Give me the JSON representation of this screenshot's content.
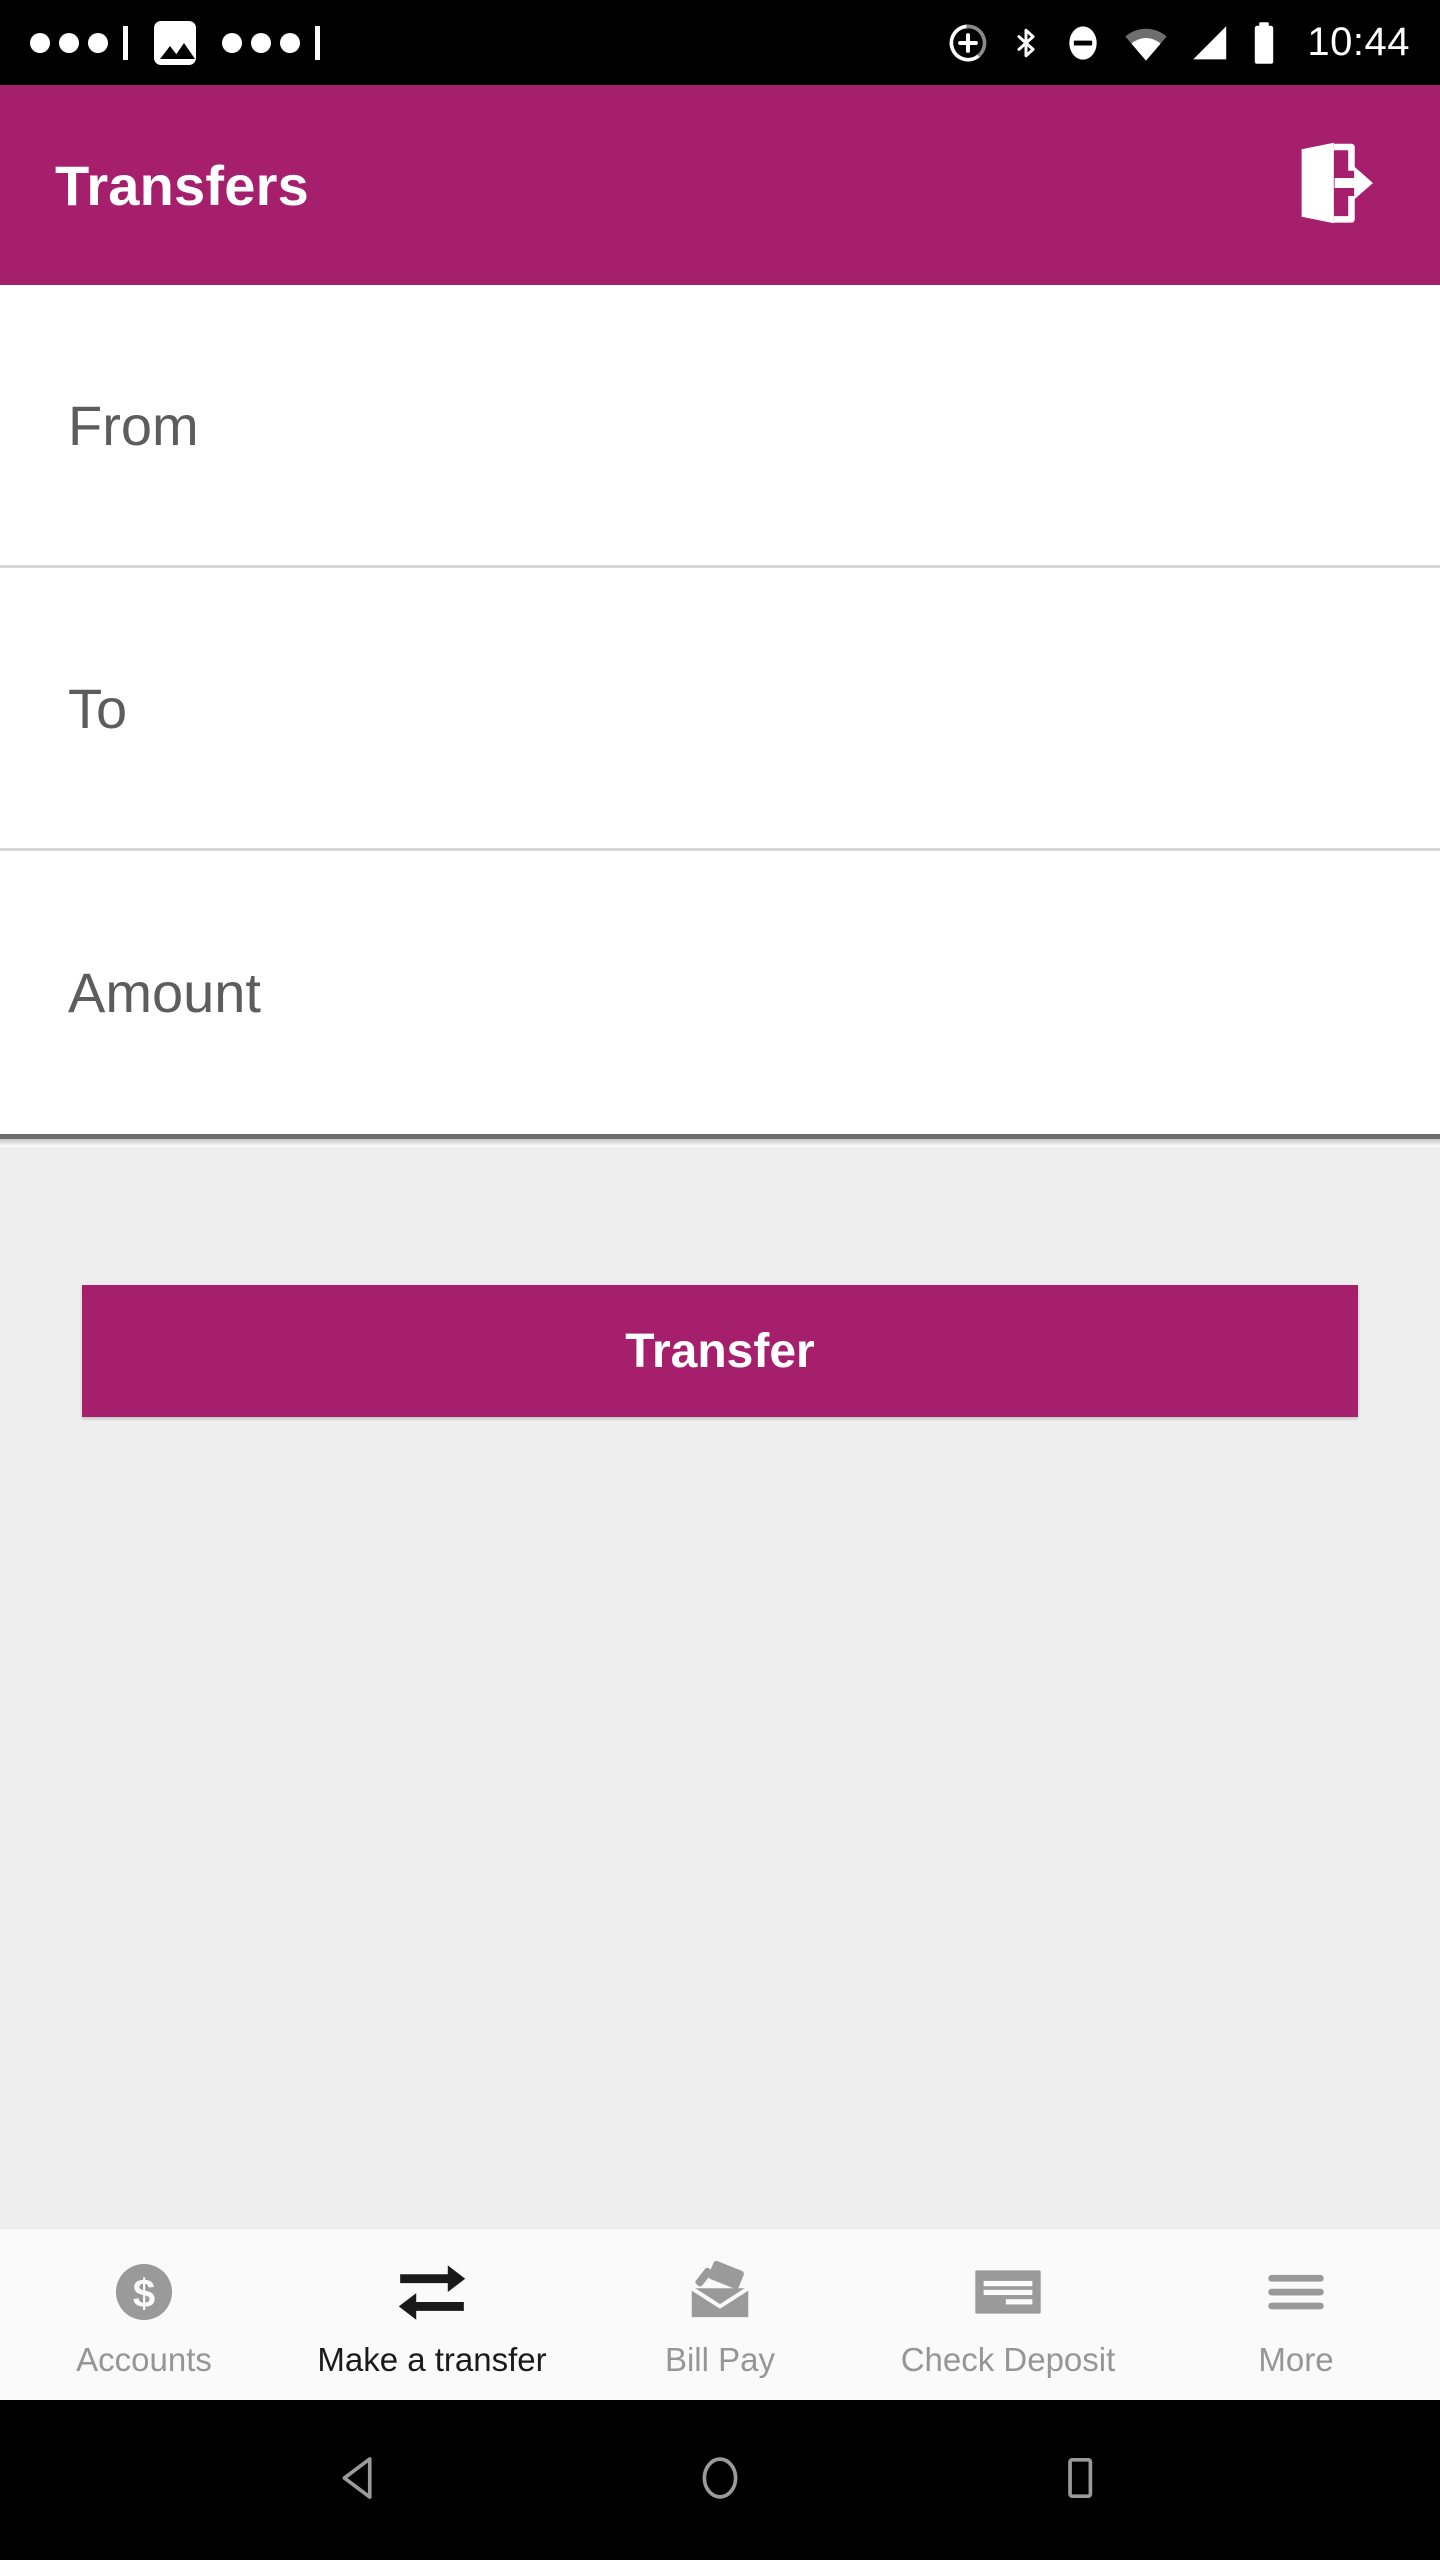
{
  "status_bar": {
    "time": "10:44",
    "left_icons": [
      "notification-dots",
      "image-icon",
      "notification-dots"
    ],
    "right_icons": [
      "location-add-icon",
      "bluetooth-icon",
      "do-not-disturb-icon",
      "wifi-icon",
      "cellular-signal-icon",
      "battery-icon"
    ],
    "background_color": "#000000"
  },
  "app_bar": {
    "title": "Transfers",
    "logout_icon": "logout-icon",
    "background_color": "#a51f6d",
    "text_color": "#ffffff"
  },
  "form": {
    "fields": [
      {
        "name": "from",
        "placeholder": "From",
        "value": ""
      },
      {
        "name": "to",
        "placeholder": "To",
        "value": ""
      },
      {
        "name": "amount",
        "placeholder": "Amount",
        "value": ""
      }
    ]
  },
  "action": {
    "transfer_label": "Transfer",
    "button_color": "#a51f6d",
    "panel_color": "#eeeeee"
  },
  "tab_bar": {
    "items": [
      {
        "label": "Accounts",
        "icon": "dollar-circle-icon",
        "active": false
      },
      {
        "label": "Make a transfer",
        "icon": "transfer-arrows-icon",
        "active": true
      },
      {
        "label": "Bill Pay",
        "icon": "envelope-mail-icon",
        "active": false
      },
      {
        "label": "Check Deposit",
        "icon": "check-card-icon",
        "active": false
      },
      {
        "label": "More",
        "icon": "hamburger-menu-icon",
        "active": false
      }
    ],
    "active_color": "#1a1a1a",
    "inactive_color": "#969696"
  },
  "android_nav": {
    "buttons": [
      "back-icon",
      "home-icon",
      "recents-icon"
    ]
  }
}
